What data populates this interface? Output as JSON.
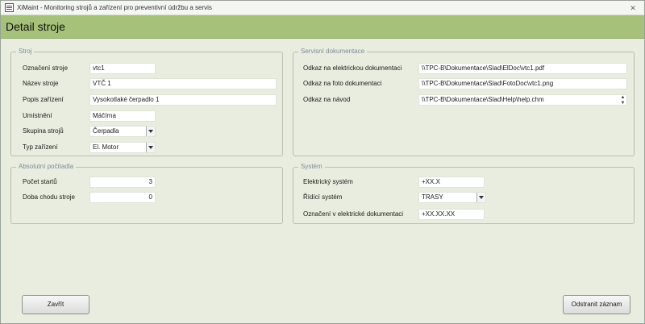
{
  "window": {
    "title": "XiMaint - Monitoring strojů a zařízení pro preventivní údržbu a servis",
    "close_glyph": "✕"
  },
  "header": {
    "title": "Detail stroje"
  },
  "stroj": {
    "title": "Stroj",
    "oznaceni": {
      "label": "Označení stroje",
      "value": "vtc1"
    },
    "nazev": {
      "label": "Název stroje",
      "value": "VTČ 1"
    },
    "popis": {
      "label": "Popis zařízení",
      "value": "Vysokotlaké čerpadlo 1"
    },
    "umisteni": {
      "label": "Umístnění",
      "value": "Máčírna"
    },
    "skupina": {
      "label": "Skupina strojů",
      "value": "Čerpadla"
    },
    "typ": {
      "label": "Typ zařízení",
      "value": "El. Motor"
    }
  },
  "servisni": {
    "title": "Servisní dokumentace",
    "elektro": {
      "label": "Odkaz na elektrickou dokumentaci",
      "value": "\\\\TPC-B\\Dokumentace\\Slad\\ElDoc\\vtc1.pdf"
    },
    "foto": {
      "label": "Odkaz na foto dokumentaci",
      "value": "\\\\TPC-B\\Dokumentace\\Slad\\FotoDoc\\vtc1.png"
    },
    "navod": {
      "label": "Odkaz na návod",
      "value": "\\\\TPC-B\\Dokumentace\\Slad\\Help\\help.chm"
    },
    "spin_glyph": "▲\n▼"
  },
  "pocitadla": {
    "title": "Absolutní počítadla",
    "starty": {
      "label": "Počet startů",
      "value": "3"
    },
    "doba": {
      "label": "Doba chodu stroje",
      "value": "0"
    }
  },
  "system": {
    "title": "Systém",
    "elektricky": {
      "label": "Elektrický systém",
      "value": "+XX.X"
    },
    "ridici": {
      "label": "Řídící systém",
      "value": "TRASY"
    },
    "oznaceni": {
      "label": "Označení v elektrické dokumentaci",
      "value": "+XX.XX.XX"
    }
  },
  "buttons": {
    "close": "Zavřít",
    "delete": "Odstranit záznam"
  }
}
